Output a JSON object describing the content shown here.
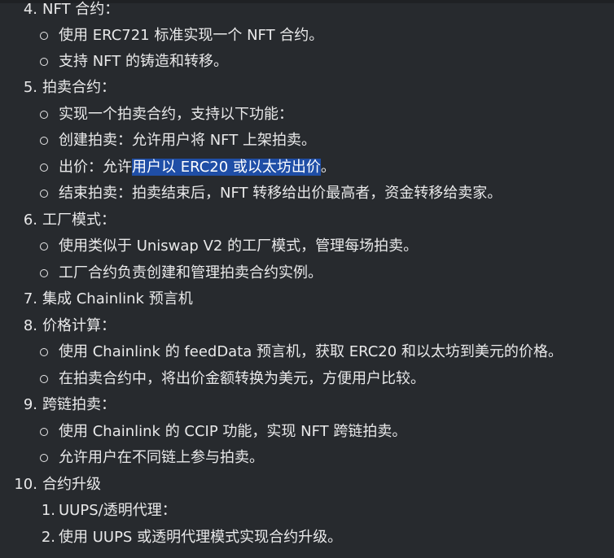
{
  "lines": [
    {
      "num": "4.",
      "text": "NFT 合约："
    },
    {
      "text": "使用 ERC721 标准实现一个 NFT 合约。"
    },
    {
      "text": "支持 NFT 的铸造和转移。"
    },
    {
      "num": "5.",
      "text": "拍卖合约："
    },
    {
      "text": "实现一个拍卖合约，支持以下功能："
    },
    {
      "text": "创建拍卖：允许用户将 NFT 上架拍卖。"
    },
    {
      "pre": "出价：允许",
      "hl": "用户以 ERC20 或以太坊出价",
      "post": "。"
    },
    {
      "text": "结束拍卖：拍卖结束后，NFT 转移给出价最高者，资金转移给卖家。"
    },
    {
      "num": "6.",
      "text": "工厂模式："
    },
    {
      "text": "使用类似于 Uniswap V2 的工厂模式，管理每场拍卖。"
    },
    {
      "text": "工厂合约负责创建和管理拍卖合约实例。"
    },
    {
      "num": "7.",
      "text": "集成 Chainlink 预言机"
    },
    {
      "num": "8.",
      "text": "价格计算："
    },
    {
      "text": "使用 Chainlink 的 feedData 预言机，获取 ERC20 和以太坊到美元的价格。"
    },
    {
      "text": "在拍卖合约中，将出价金额转换为美元，方便用户比较。"
    },
    {
      "num": "9.",
      "text": "跨链拍卖："
    },
    {
      "text": "使用 Chainlink 的 CCIP 功能，实现 NFT 跨链拍卖。"
    },
    {
      "text": "允许用户在不同链上参与拍卖。"
    },
    {
      "num": "10.",
      "text": "合约升级"
    },
    {
      "num": "1.",
      "text": "UUPS/透明代理："
    },
    {
      "num": "2.",
      "text": "使用 UUPS 或透明代理模式实现合约升级。"
    }
  ]
}
